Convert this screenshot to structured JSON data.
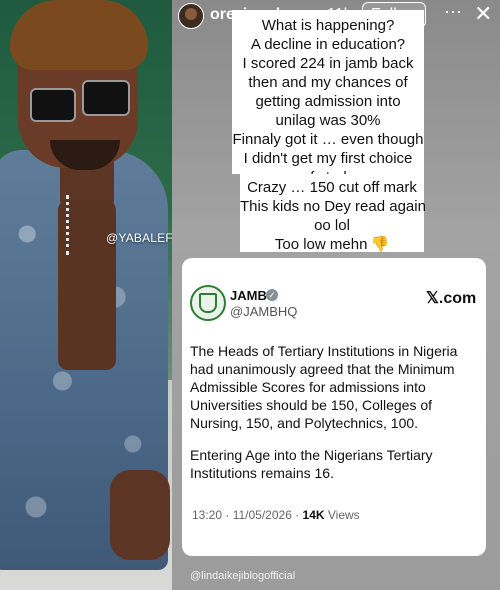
{
  "story": {
    "username": "oreziworl...",
    "separator": "•",
    "time": "11h",
    "follow_label": "Follow",
    "more_label": "⋯",
    "close_label": "✕",
    "watermark": "@YABALEFTONLINE",
    "credit": "@lindaikejiblogofficial"
  },
  "captions": {
    "first": [
      "What is happening?",
      "A decline in education?",
      "I scored 224 in jamb back",
      "then and my chances of",
      "getting admission into",
      "unilag was 30%",
      "Finnaly got it … even though",
      "I didn't get my first choice",
      "of study"
    ],
    "second": [
      "Crazy … 150 cut off mark",
      "This kids no Dey read again",
      "oo lol",
      "Too low mehn"
    ],
    "emoji": "👎"
  },
  "tweet": {
    "name": "JAMB",
    "verified_mark": "✓",
    "handle": "@JAMBHQ",
    "source": "𝕏.com",
    "paragraph1": "The Heads of Tertiary Institutions in Nigeria had unanimously agreed that the Minimum Admissible Scores for admissions into Universities should be 150, Colleges of Nursing, 150, and Polytechnics, 100.",
    "paragraph2": "Entering Age into the Nigerians Tertiary Institutions remains 16.",
    "timestamp": "13:20 · 11/05/2026 · ",
    "views_count": "14K",
    "views_label": " Views"
  }
}
